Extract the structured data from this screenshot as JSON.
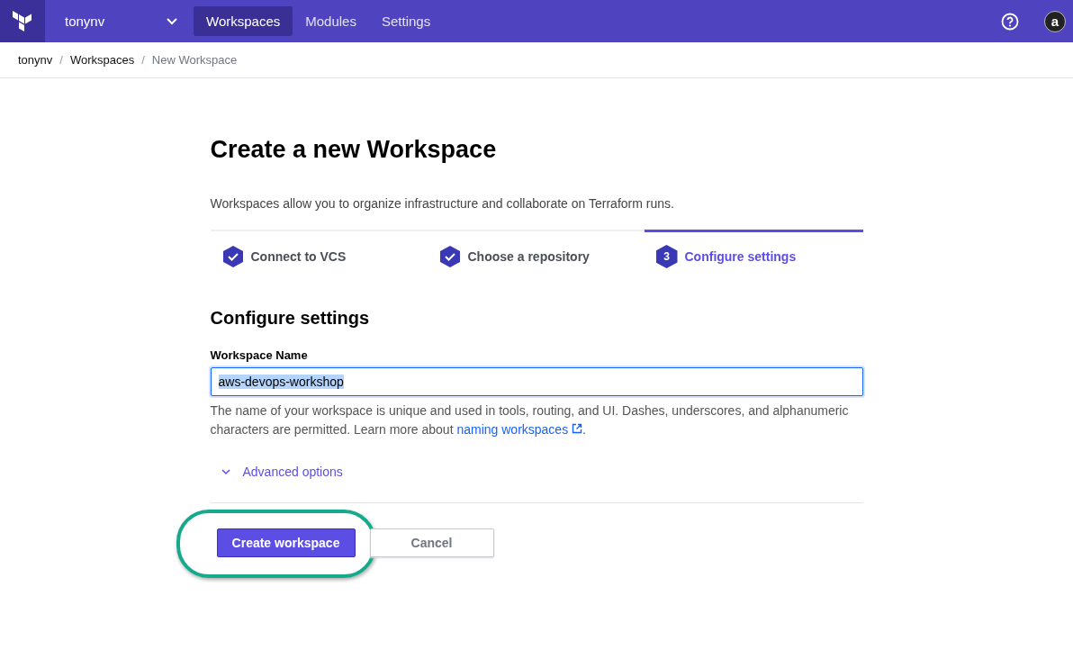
{
  "nav": {
    "org": "tonynv",
    "links": [
      {
        "label": "Workspaces",
        "selected": true
      },
      {
        "label": "Modules",
        "selected": false
      },
      {
        "label": "Settings",
        "selected": false
      }
    ],
    "avatar_letter": "a"
  },
  "breadcrumb_separator": "/",
  "breadcrumbs": [
    {
      "label": "tonynv",
      "current": false
    },
    {
      "label": "Workspaces",
      "current": false
    },
    {
      "label": "New Workspace",
      "current": true
    }
  ],
  "title": "Create a new Workspace",
  "intro": "Workspaces allow you to organize infrastructure and collaborate on Terraform runs.",
  "steps": [
    {
      "label": "Connect to VCS",
      "done": true,
      "selected": false
    },
    {
      "label": "Choose a repository",
      "done": true,
      "selected": false
    },
    {
      "label": "Configure settings",
      "number": "3",
      "done": false,
      "selected": true
    }
  ],
  "section_title": "Configure settings",
  "field": {
    "label": "Workspace Name",
    "value": "aws-devops-workshop",
    "selected_text": true
  },
  "help": {
    "before": "The name of your workspace is unique and used in tools, routing, and UI. Dashes, underscores, and alphanumeric characters are permitted. Learn more about ",
    "link": "naming workspaces",
    "after": "."
  },
  "advanced": {
    "label": "Advanced options",
    "expanded": false
  },
  "buttons": [
    {
      "label": "Create workspace",
      "kind": "primary",
      "highlighted": true
    },
    {
      "label": "Cancel",
      "kind": "secondary",
      "highlighted": false
    }
  ]
}
